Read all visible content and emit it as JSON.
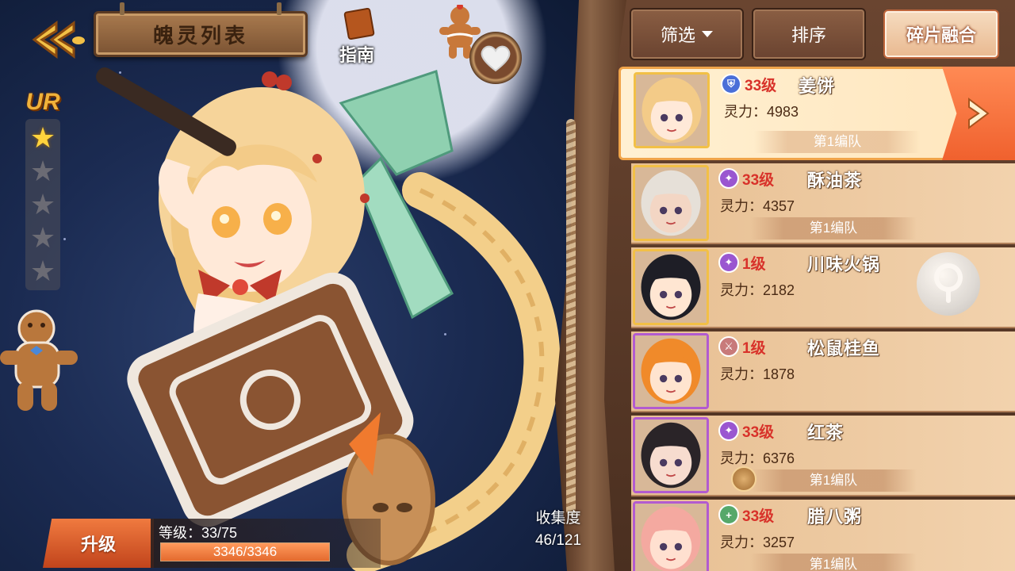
{
  "screen": {
    "title": "魄灵列表",
    "guide_label": "指南",
    "rarity": "UR",
    "stars": {
      "filled": 1,
      "total": 5
    }
  },
  "level_panel": {
    "upgrade_label": "升级",
    "level_text": "等级：33/75",
    "exp_text": "3346/3346",
    "exp_fraction": 1.0
  },
  "collection": {
    "label": "收集度",
    "value": "46/121"
  },
  "toolbar": {
    "filter_label": "筛选",
    "sort_label": "排序",
    "fuse_label": "碎片融合"
  },
  "roster": [
    {
      "class_icon": "shield-icon",
      "class_color": "#4a6fd8",
      "level": "33级",
      "name": "姜饼",
      "power": "灵力：4983",
      "team": "第1编队",
      "frame": "gold",
      "selected": true
    },
    {
      "class_icon": "star-badge-icon",
      "class_color": "#9a56d0",
      "level": "33级",
      "name": "酥油茶",
      "power": "灵力：4357",
      "team": "第1编队",
      "frame": "gold",
      "selected": false
    },
    {
      "class_icon": "star-badge-icon",
      "class_color": "#9a56d0",
      "level": "1级",
      "name": "川味火锅",
      "power": "灵力：2182",
      "team": "",
      "frame": "gold",
      "selected": false
    },
    {
      "class_icon": "sword-icon",
      "class_color": "#c87a7a",
      "level": "1级",
      "name": "松鼠桂鱼",
      "power": "灵力：1878",
      "team": "",
      "frame": "purple",
      "selected": false
    },
    {
      "class_icon": "star-badge-icon",
      "class_color": "#9a56d0",
      "level": "33级",
      "name": "红茶",
      "power": "灵力：6376",
      "team": "第1编队",
      "frame": "purple",
      "selected": false
    },
    {
      "class_icon": "plus-icon",
      "class_color": "#56a86a",
      "level": "33级",
      "name": "腊八粥",
      "power": "灵力：3257",
      "team": "第1编队",
      "frame": "purple",
      "selected": false
    }
  ]
}
